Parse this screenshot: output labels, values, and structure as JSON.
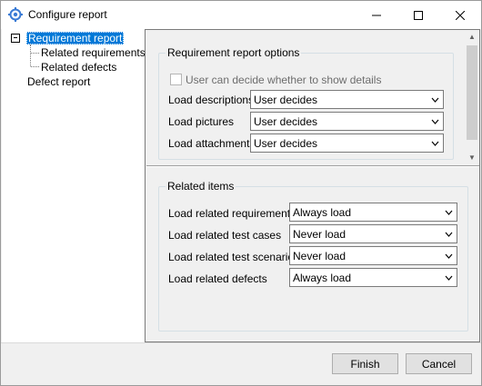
{
  "window": {
    "title": "Configure report"
  },
  "tree": {
    "items": [
      {
        "label": "Requirement report"
      },
      {
        "label": "Related requirements"
      },
      {
        "label": "Related defects"
      },
      {
        "label": "Defect report"
      }
    ]
  },
  "requirement_options": {
    "title": "Requirement report options",
    "checkbox_label": "User can decide whether to show details",
    "fields": [
      {
        "label": "Load descriptions",
        "value": "User decides"
      },
      {
        "label": "Load pictures",
        "value": "User decides"
      },
      {
        "label": "Load attachments",
        "value": "User decides"
      }
    ]
  },
  "related_items": {
    "title": "Related items",
    "fields": [
      {
        "label": "Load related requirements",
        "value": "Always load"
      },
      {
        "label": "Load related test cases",
        "value": "Never load"
      },
      {
        "label": "Load related test scenarios",
        "value": "Never load"
      },
      {
        "label": "Load related defects",
        "value": "Always load"
      }
    ]
  },
  "footer": {
    "finish_label": "Finish",
    "cancel_label": "Cancel"
  },
  "colors": {
    "selection": "#0078d7",
    "window_bg": "#f0f0f0"
  }
}
